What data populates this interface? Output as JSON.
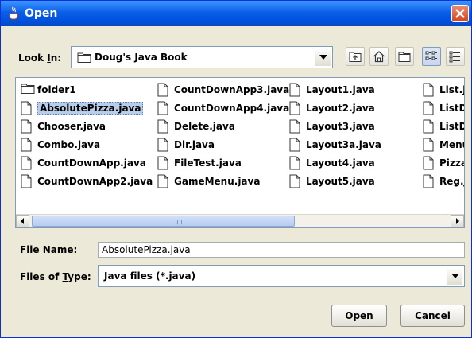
{
  "window": {
    "title": "Open",
    "app_icon": "java-cup-icon",
    "close_icon": "close-icon",
    "titlebar_color": "#0a5fe8",
    "close_color": "#d5431d"
  },
  "look_in": {
    "label_pre": "Look ",
    "label_mnemonic": "I",
    "label_post": "n:",
    "value": "Doug's Java Book",
    "folder_icon": "folder-icon"
  },
  "toolbar": {
    "up_icon": "up-one-level-icon",
    "home_icon": "home-icon",
    "new_folder_icon": "new-folder-icon",
    "list_icon": "list-view-icon",
    "details_icon": "details-view-icon",
    "active_view": "list"
  },
  "files": {
    "columns": [
      [
        "folder1",
        "AbsolutePizza.java",
        "Chooser.java",
        "Combo.java",
        "CountDownApp.java",
        "CountDownApp2.java"
      ],
      [
        "CountDownApp3.java",
        "CountDownApp4.java",
        "Delete.java",
        "Dir.java",
        "FileTest.java",
        "GameMenu.java"
      ],
      [
        "Layout1.java",
        "Layout2.java",
        "Layout3.java",
        "Layout3a.java",
        "Layout4.java",
        "Layout5.java"
      ],
      [
        "List.j",
        "ListD",
        "ListD",
        "Menu",
        "Pizza",
        "Reg.j"
      ]
    ],
    "selected": "AbsolutePizza.java",
    "selection_color": "#b7cde8"
  },
  "file_name": {
    "label_pre": "File ",
    "label_mnemonic": "N",
    "label_post": "ame:",
    "value": "AbsolutePizza.java"
  },
  "files_of_type": {
    "label_pre": "Files of ",
    "label_mnemonic": "T",
    "label_post": "ype:",
    "value": "Java files (*.java)"
  },
  "buttons": {
    "open": "Open",
    "cancel": "Cancel"
  }
}
